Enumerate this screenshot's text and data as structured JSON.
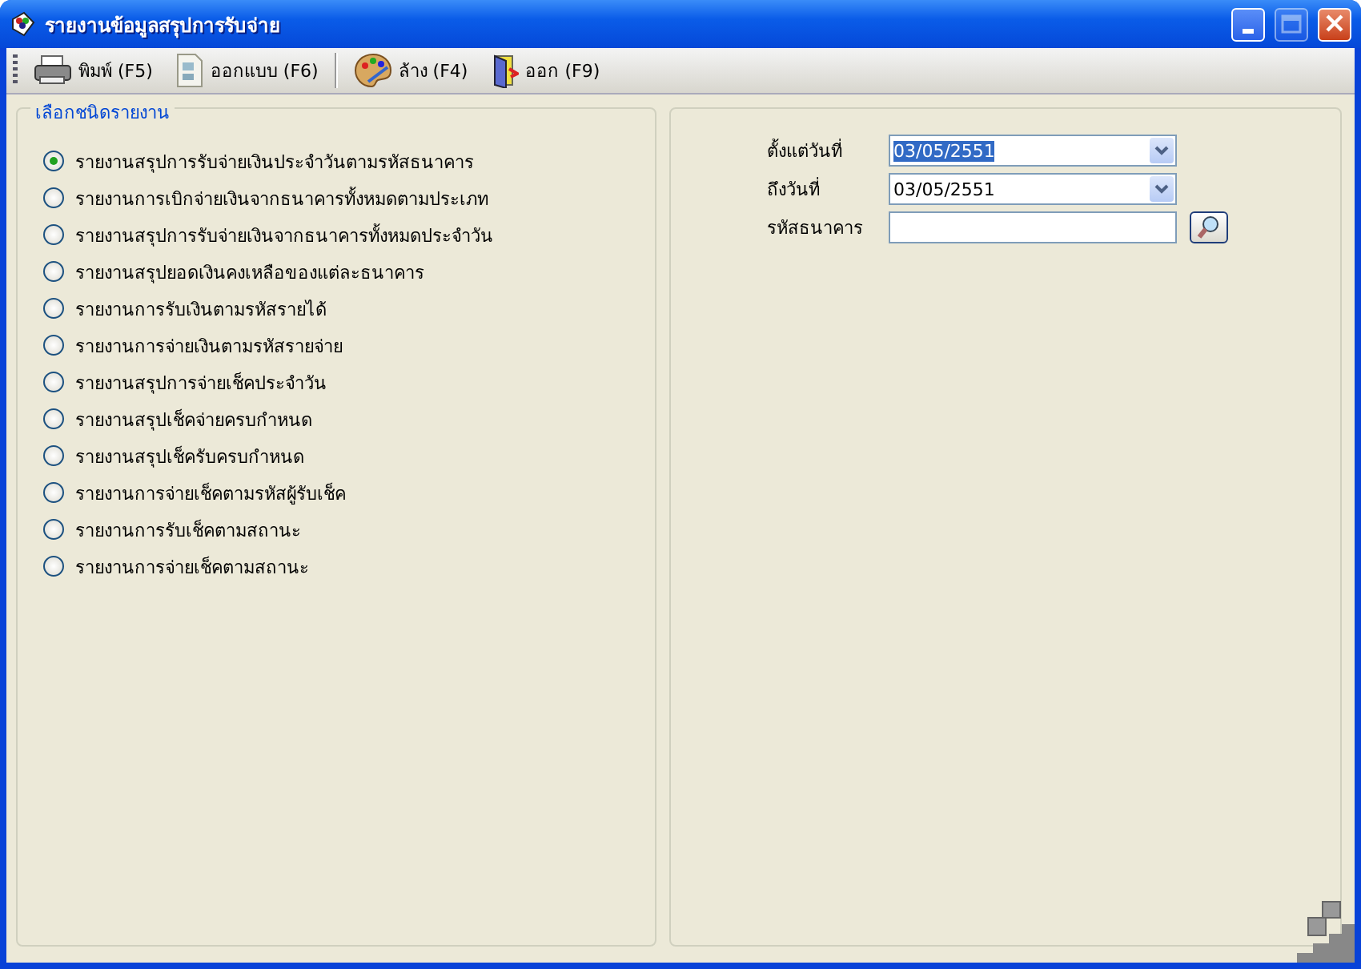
{
  "window": {
    "title": "รายงานข้อมูลสรุปการรับจ่าย",
    "controls": [
      {
        "kind": "minimize",
        "disabled": false
      },
      {
        "kind": "maximize",
        "disabled": true
      },
      {
        "kind": "close",
        "disabled": false
      }
    ]
  },
  "toolbar": [
    {
      "kind": "print",
      "label": "พิมพ์ (F5)"
    },
    {
      "kind": "design",
      "label": "ออกแบบ (F6)"
    },
    {
      "kind": "separator"
    },
    {
      "kind": "clear",
      "label": "ล้าง (F4)"
    },
    {
      "kind": "exit",
      "label": "ออก (F9)"
    }
  ],
  "report_group": {
    "title": "เลือกชนิดรายงาน",
    "options": [
      {
        "label": "รายงานสรุปการรับจ่ายเงินประจำวันตามรหัสธนาคาร",
        "selected": true
      },
      {
        "label": "รายงานการเบิกจ่ายเงินจากธนาคารทั้งหมดตามประเภท",
        "selected": false
      },
      {
        "label": "รายงานสรุปการรับจ่ายเงินจากธนาคารทั้งหมดประจำวัน",
        "selected": false
      },
      {
        "label": "รายงานสรุปยอดเงินคงเหลือของแต่ละธนาคาร",
        "selected": false
      },
      {
        "label": "รายงานการรับเงินตามรหัสรายได้",
        "selected": false
      },
      {
        "label": "รายงานการจ่ายเงินตามรหัสรายจ่าย",
        "selected": false
      },
      {
        "label": "รายงานสรุปการจ่ายเช็คประจำวัน",
        "selected": false
      },
      {
        "label": "รายงานสรุปเช็คจ่ายครบกำหนด",
        "selected": false
      },
      {
        "label": "รายงานสรุปเช็ครับครบกำหนด",
        "selected": false
      },
      {
        "label": "รายงานการจ่ายเช็คตามรหัสผู้รับเช็ค",
        "selected": false
      },
      {
        "label": "รายงานการรับเช็คตามสถานะ",
        "selected": false
      },
      {
        "label": "รายงานการจ่ายเช็คตามสถานะ",
        "selected": false
      }
    ]
  },
  "filters": [
    {
      "kind": "dropdown",
      "label": "ตั้งแต่วันที่",
      "value": "03/05/2551",
      "highlighted": true
    },
    {
      "kind": "dropdown",
      "label": "ถึงวันที่",
      "value": "03/05/2551",
      "highlighted": false
    },
    {
      "kind": "lookup",
      "label": "รหัสธนาคาร"
    }
  ]
}
